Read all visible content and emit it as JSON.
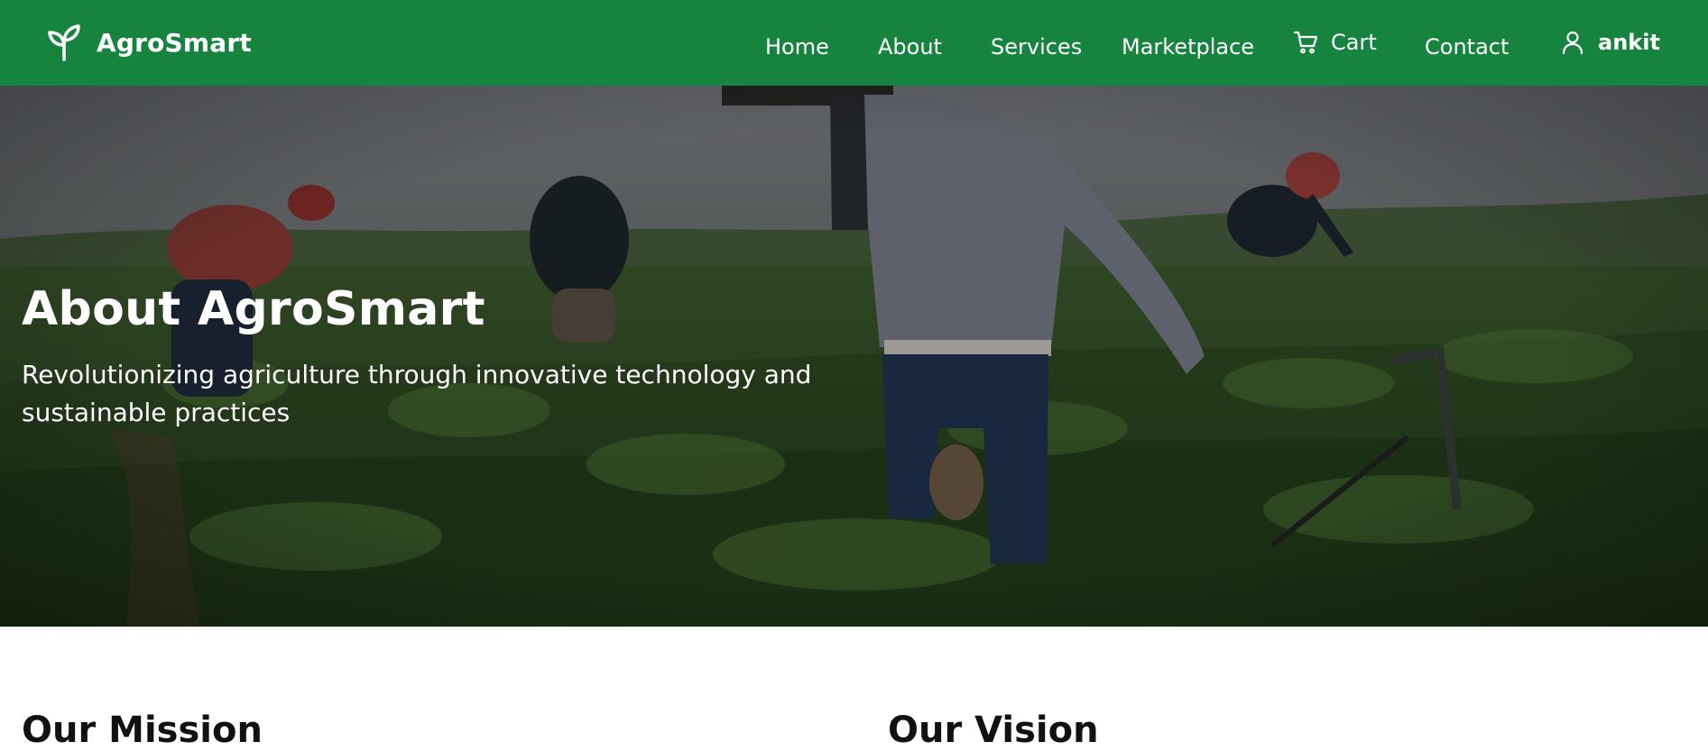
{
  "brand": {
    "name": "AgroSmart",
    "icon": "sprout-icon"
  },
  "nav": {
    "home": "Home",
    "about": "About",
    "services": "Services",
    "marketplace": "Marketplace",
    "cart": "Cart",
    "cart_icon": "cart-icon",
    "contact": "Contact",
    "user": "ankit",
    "user_icon": "user-icon"
  },
  "hero": {
    "title": "About AgroSmart",
    "subtitle": "Revolutionizing agriculture through innovative technology and sustainable practices"
  },
  "sections": {
    "mission_title": "Our Mission",
    "vision_title": "Our Vision"
  },
  "colors": {
    "navbar": "#16843f",
    "text_light": "#ffffff",
    "heading_dark": "#111111"
  }
}
